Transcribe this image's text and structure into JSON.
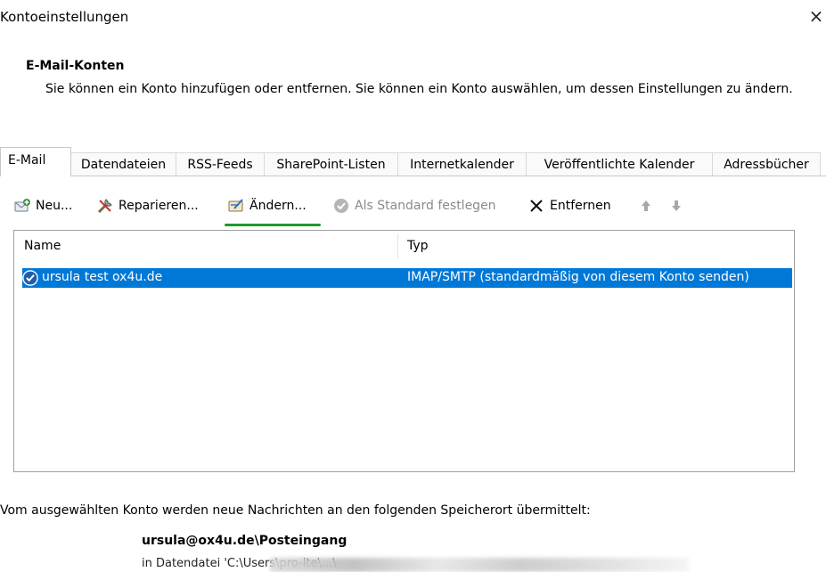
{
  "window": {
    "title": "Kontoeinstellungen",
    "close_symbol": "×"
  },
  "header": {
    "section_title": "E-Mail-Konten",
    "description": "Sie können ein Konto hinzufügen oder entfernen. Sie können ein Konto auswählen, um dessen Einstellungen zu ändern."
  },
  "tabs": [
    {
      "label": "E-Mail",
      "active": true
    },
    {
      "label": "Datendateien"
    },
    {
      "label": "RSS-Feeds"
    },
    {
      "label": "SharePoint-Listen"
    },
    {
      "label": "Internetkalender"
    },
    {
      "label": "Veröffentlichte Kalender"
    },
    {
      "label": "Adressbücher"
    }
  ],
  "toolbar": {
    "new_label": "Neu...",
    "repair_label": "Reparieren...",
    "change_label": "Ändern...",
    "set_default_label": "Als Standard festlegen",
    "remove_label": "Entfernen",
    "up_icon": "arrow-up-icon",
    "down_icon": "arrow-down-icon"
  },
  "list": {
    "columns": [
      "Name",
      "Typ"
    ],
    "rows": [
      {
        "name": "ursula test ox4u.de",
        "type": "IMAP/SMTP (standardmäßig von diesem Konto senden)",
        "selected": true
      }
    ]
  },
  "footer": {
    "delivery_text": "Vom ausgewählten Konto werden neue Nachrichten an den folgenden Speicherort übermittelt:",
    "store_path": "ursula@ox4u.de\\Posteingang",
    "data_file": "in Datendatei 'C:\\Users\\pro-ite\\...\\"
  },
  "colors": {
    "selection": "#0078d7",
    "highlight_underline": "#1e9a2b"
  }
}
